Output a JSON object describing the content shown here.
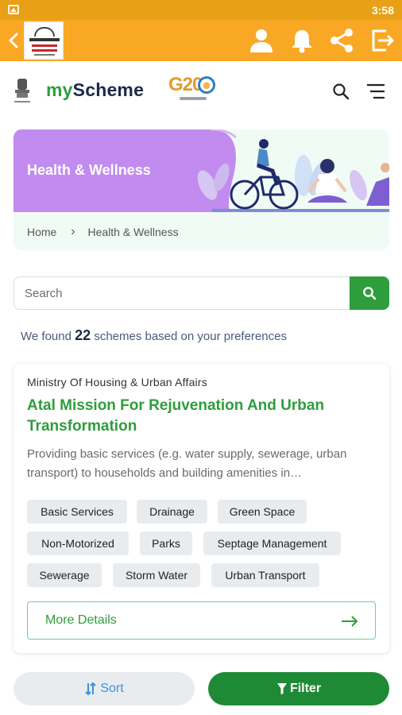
{
  "status_bar": {
    "time": "3:58"
  },
  "header": {
    "brand_my": "my",
    "brand_scheme": "Scheme",
    "g20": "G20"
  },
  "banner": {
    "title": "Health & Wellness",
    "breadcrumb": [
      "Home",
      "Health & Wellness"
    ]
  },
  "search": {
    "placeholder": "Search"
  },
  "results": {
    "prefix": "We found",
    "count": "22",
    "suffix": "schemes based on your preferences"
  },
  "scheme": {
    "ministry": "Ministry Of Housing & Urban Affairs",
    "title": "Atal Mission For Rejuvenation And Urban Transformation",
    "description": "Providing basic services (e.g. water supply, sewerage, urban transport) to households and building amenities in…",
    "tags": [
      "Basic Services",
      "Drainage",
      "Green Space",
      "Non-Motorized",
      "Parks",
      "Septage Management",
      "Sewerage",
      "Storm Water",
      "Urban Transport"
    ],
    "more_details": "More Details"
  },
  "bottom": {
    "sort": "Sort",
    "filter": "Filter"
  },
  "colors": {
    "appbar": "#f9a825",
    "green": "#2e9d3c",
    "banner_purple": "#c18bef",
    "navy": "#1b2a4a"
  },
  "icons": [
    "back-icon",
    "user-icon",
    "bell-icon",
    "share-icon",
    "exit-icon",
    "search-icon",
    "menu-icon",
    "arrow-right-icon",
    "sort-icon",
    "filter-icon"
  ]
}
